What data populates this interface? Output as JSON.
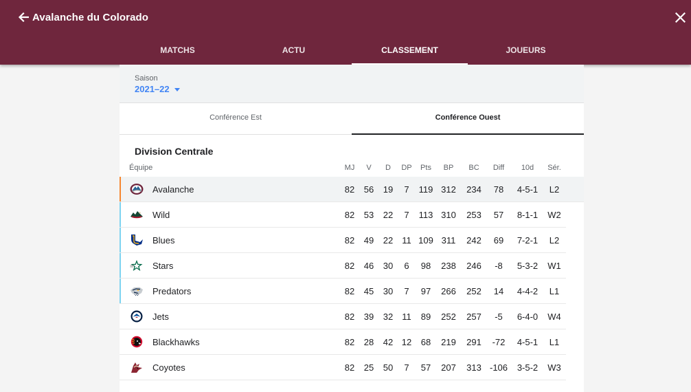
{
  "header": {
    "title": "Avalanche du Colorado",
    "tabs": [
      "MATCHS",
      "ACTU",
      "CLASSEMENT",
      "JOUEURS"
    ]
  },
  "season": {
    "label": "Saison",
    "value": "2021–22"
  },
  "conferences": [
    "Conférence Est",
    "Conférence Ouest"
  ],
  "division": "Division Centrale",
  "columns": {
    "team": "Équipe",
    "stats": [
      "MJ",
      "V",
      "D",
      "DP",
      "Pts",
      "BP",
      "BC",
      "Diff",
      "10d",
      "Sér."
    ]
  },
  "rows": [
    {
      "name": "Avalanche",
      "logo": "avalanche-logo",
      "stats": [
        "82",
        "56",
        "19",
        "7",
        "119",
        "312",
        "234",
        "78",
        "4-5-1",
        "L2"
      ]
    },
    {
      "name": "Wild",
      "logo": "wild-logo",
      "stats": [
        "82",
        "53",
        "22",
        "7",
        "113",
        "310",
        "253",
        "57",
        "8-1-1",
        "W2"
      ]
    },
    {
      "name": "Blues",
      "logo": "blues-logo",
      "stats": [
        "82",
        "49",
        "22",
        "11",
        "109",
        "311",
        "242",
        "69",
        "7-2-1",
        "L2"
      ]
    },
    {
      "name": "Stars",
      "logo": "stars-logo",
      "stats": [
        "82",
        "46",
        "30",
        "6",
        "98",
        "238",
        "246",
        "-8",
        "5-3-2",
        "W1"
      ]
    },
    {
      "name": "Predators",
      "logo": "predators-logo",
      "stats": [
        "82",
        "45",
        "30",
        "7",
        "97",
        "266",
        "252",
        "14",
        "4-4-2",
        "L1"
      ]
    },
    {
      "name": "Jets",
      "logo": "jets-logo",
      "stats": [
        "82",
        "39",
        "32",
        "11",
        "89",
        "252",
        "257",
        "-5",
        "6-4-0",
        "W4"
      ]
    },
    {
      "name": "Blackhawks",
      "logo": "blackhawks-logo",
      "stats": [
        "82",
        "28",
        "42",
        "12",
        "68",
        "219",
        "291",
        "-72",
        "4-5-1",
        "L1"
      ]
    },
    {
      "name": "Coyotes",
      "logo": "coyotes-logo",
      "stats": [
        "82",
        "25",
        "50",
        "7",
        "57",
        "207",
        "313",
        "-106",
        "3-5-2",
        "W3"
      ]
    }
  ],
  "colors": {
    "header_bg": "#6f263d",
    "accent_blue": "#4285f4",
    "selected_indicator": "#f5862f",
    "playoff_indicator": "#7fd3f0"
  }
}
